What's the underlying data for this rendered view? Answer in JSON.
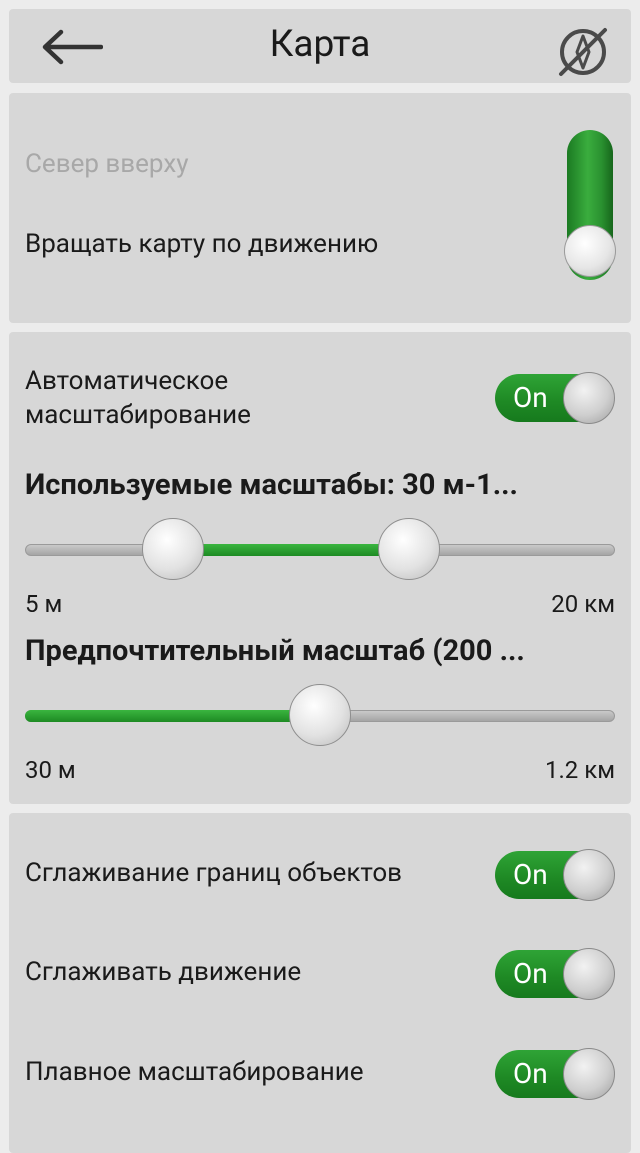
{
  "header": {
    "title": "Карта",
    "back_icon": "arrow-left-icon",
    "compass_icon": "compass-disabled-icon"
  },
  "orientation": {
    "north_up_label": "Север вверху",
    "rotate_label": "Вращать карту по движению",
    "selected": "rotate"
  },
  "scale": {
    "auto_zoom_label_1": "Автоматическое",
    "auto_zoom_label_2": "масштабирование",
    "auto_zoom_state": "On",
    "used_scales_title": "Используемые масштабы: 30 м-1...",
    "used_scales_min": "5 м",
    "used_scales_max": "20 км",
    "used_scales_low_fraction": 0.25,
    "used_scales_high_fraction": 0.65,
    "preferred_title": "Предпочтительный масштаб (200 ...",
    "preferred_min": "30 м",
    "preferred_max": "1.2 км",
    "preferred_fraction": 0.5
  },
  "options": {
    "items": [
      {
        "label": "Сглаживание границ объектов",
        "state": "On"
      },
      {
        "label": "Сглаживать движение",
        "state": "On"
      },
      {
        "label": "Плавное масштабирование",
        "state": "On"
      }
    ]
  },
  "colors": {
    "accent_green": "#1f8a25",
    "panel_bg": "#d7d7d7",
    "page_bg": "#ececec"
  }
}
